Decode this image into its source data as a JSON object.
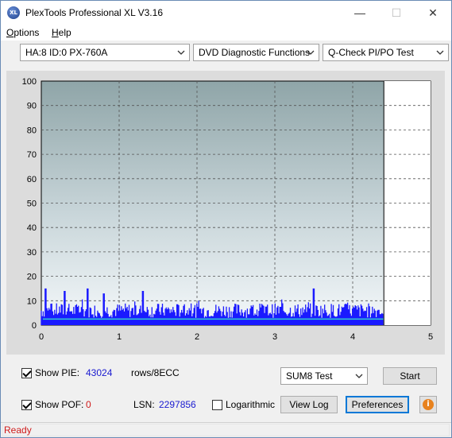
{
  "window": {
    "title": "PlexTools Professional XL V3.16",
    "icon_text": "XL",
    "min": "—",
    "max": "☐",
    "close": "✕"
  },
  "menu": [
    {
      "label": "Options",
      "accel": "O",
      "rest": "ptions"
    },
    {
      "label": "Help",
      "accel": "H",
      "rest": "elp"
    }
  ],
  "toolbar": {
    "drive": "HA:8 ID:0  PX-760A",
    "function": "DVD Diagnostic Functions",
    "test": "Q-Check PI/PO Test"
  },
  "chart_data": {
    "type": "area",
    "x_ticks": [
      "0",
      "1",
      "2",
      "3",
      "4",
      "5"
    ],
    "y_ticks": [
      "0",
      "10",
      "20",
      "30",
      "40",
      "50",
      "60",
      "70",
      "80",
      "90",
      "100"
    ],
    "xlim": [
      0,
      5
    ],
    "ylim": [
      0,
      100
    ],
    "data_end_x": 4.4,
    "grid": true,
    "series": [
      {
        "color": "#1a1aff",
        "profile": "noise",
        "typical_range": [
          3,
          9
        ],
        "peak_values": [
          15,
          14,
          15,
          13,
          14,
          15
        ]
      },
      {
        "color": "#33cccc",
        "profile": "flat",
        "value": 2.5
      }
    ]
  },
  "controls": {
    "show_pie_label": "Show PIE:",
    "pie_value": "43024",
    "pie_units": "rows/8ECC",
    "show_pof_label": "Show POF:",
    "pof_value": "0",
    "lsn_label": "LSN:",
    "lsn_value": "2297856",
    "log_label": "Logarithmic",
    "sum8_select": "SUM8 Test",
    "start_btn": "Start",
    "viewlog_btn": "View Log",
    "prefs_btn": "Preferences",
    "info": "i"
  },
  "status": {
    "text": "Ready"
  }
}
